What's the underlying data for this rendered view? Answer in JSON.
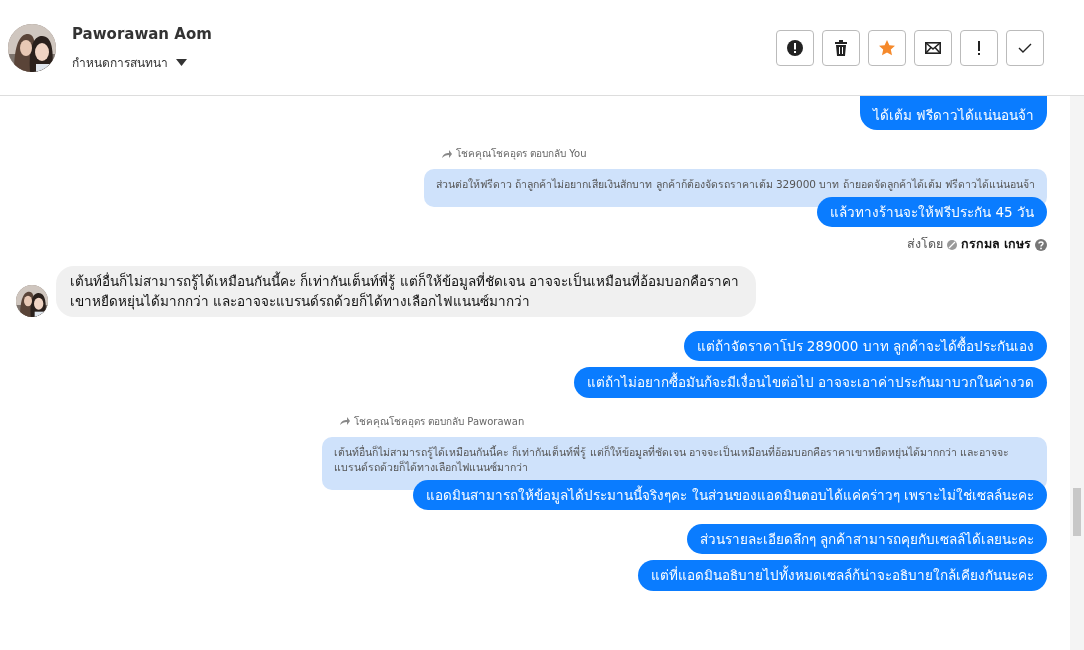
{
  "header": {
    "name": "Paworawan Aom",
    "subtitle": "กำหนดการสนทนา"
  },
  "actions": [
    {
      "kind": "alert"
    },
    {
      "kind": "trash"
    },
    {
      "kind": "star"
    },
    {
      "kind": "mail"
    },
    {
      "kind": "exclaim"
    },
    {
      "kind": "check"
    }
  ],
  "messages": [
    {
      "kind": "outgoing",
      "text": "ได้เต้ม ฟรีดาวได้แน่นอนจ้า",
      "cut": true
    },
    {
      "kind": "reply",
      "label": "โชคคุณโชคอุดร ตอบกลับ You",
      "quoted": "ส่วนต่อให้ฟรีดาว ถ้าลูกค้าไม่อยากเสียเงินสักบาท ลูกค้าก้ต้องจัดรถราคาเต้ม 329000 บาท ถ้ายอดจัดลูกค้าได้เต้ม ฟรีดาวได้แน่นอนจ้า",
      "text": "แล้วทางร้านจะให้ฟรีประกัน 45 วัน"
    },
    {
      "kind": "sent_by",
      "label": "ส่งโดย",
      "sender": "กรกมล เกษร"
    },
    {
      "kind": "incoming",
      "text": "เต้นท์อื่นก็ไม่สามารถรู้ได้เหมือนกันนี้คะ ก็เท่ากันเต็นท์พี่รู้ แต่ก็ให้ข้อมูลที่ชัดเจน อาจจะเป็นเหมือนที่อ้อมบอกคือราคาเขาหยืดหยุ่นได้มากกว่า และอาจจะแบรนด์รถด้วยก็ได้ทางเลือกไฟแนนซ์มากว่า"
    },
    {
      "kind": "outgoing",
      "text": "แต่ถ้าจัดราคาโปร 289000 บาท ลูกค้าจะได้ซื้อประกันเอง"
    },
    {
      "kind": "outgoing",
      "text": "แต่ถ้าไม่อยากซื้อมันก้จะมีเงื่อนไขต่อไป อาจจะเอาค่าประกันมาบวกในค่างวด"
    },
    {
      "kind": "reply",
      "label": "โชคคุณโชคอุดร ตอบกลับ Paworawan",
      "quoted": "เต้นท์อื่นก็ไม่สามารถรู้ได้เหมือนกันนี้คะ ก็เท่ากันเต็นท์พี่รู้ แต่ก็ให้ข้อมูลที่ชัดเจน อาจจะเป็นเหมือนที่อ้อมบอกคือราคาเขาหยืดหยุ่นได้มากกว่า และอาจจะแบรนด์รถด้วยก็ได้ทางเลือกไฟแนนซ์มากว่า",
      "text": "แอดมินสามารถให้ข้อมูลได้ประมานนี้จริงๆคะ ในส่วนของแอดมินตอบได้แค่คร่าวๆ เพราะไม่ใช่เซลล์นะคะ"
    },
    {
      "kind": "outgoing",
      "text": "ส่วนรายละเอียดลึกๆ ลูกค้าสามารถคุยกับเซลล์ได้เลยนะคะ"
    },
    {
      "kind": "outgoing",
      "text": "แต่ที่แอดมินอธิบายไปทั้งหมดเซลล์ก้น่าจะอธิบายใกล้เคียงกันนะคะ"
    }
  ]
}
